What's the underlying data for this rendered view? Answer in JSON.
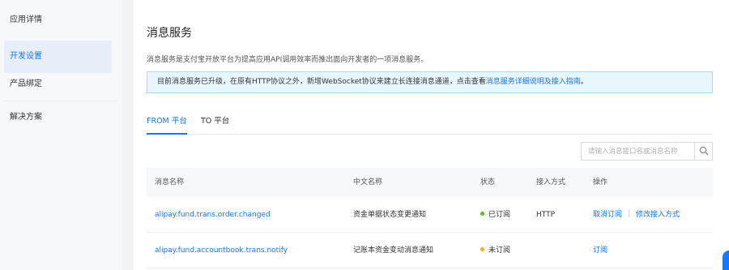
{
  "sidebar": {
    "items": [
      {
        "label": "应用详情",
        "active": false
      },
      {
        "label": "开发设置",
        "active": true
      },
      {
        "label": "产品绑定",
        "active": false
      },
      {
        "label": "解决方案",
        "active": false
      }
    ]
  },
  "main": {
    "title": "消息服务",
    "description": "消息服务是支付宝开放平台为提高应用API调用效率而推出面向开发者的一项消息服务。",
    "notice": {
      "text": "目前消息服务已升级，在原有HTTP协议之外，新增WebSocket协议来建立长连接消息通道，点击查看",
      "link": "消息服务详细说明及接入指南",
      "end": "。"
    },
    "tabs": [
      {
        "label": "FROM 平台",
        "active": true
      },
      {
        "label": "TO 平台",
        "active": false
      }
    ],
    "search": {
      "placeholder": "请输入消息接口名或消息名称"
    },
    "table": {
      "columns": [
        "消息名称",
        "中文名称",
        "状态",
        "接入方式",
        "操作"
      ],
      "rows": [
        {
          "name": "alipay.fund.trans.order.changed",
          "cn_name": "资金单据状态变更通知",
          "status": "已订阅",
          "status_color": "#52c41a",
          "access": "HTTP",
          "actions": [
            "取消订阅",
            "修改接入方式"
          ]
        },
        {
          "name": "alipay.fund.accountbook.trans.notify",
          "cn_name": "记账本资金变动消息通知",
          "status": "未订阅",
          "status_color": "#faad14",
          "access": "",
          "actions": [
            "订阅"
          ]
        }
      ]
    }
  },
  "colors": {
    "accent": "#1677ff",
    "notice_bg": "#e8f6fd"
  }
}
